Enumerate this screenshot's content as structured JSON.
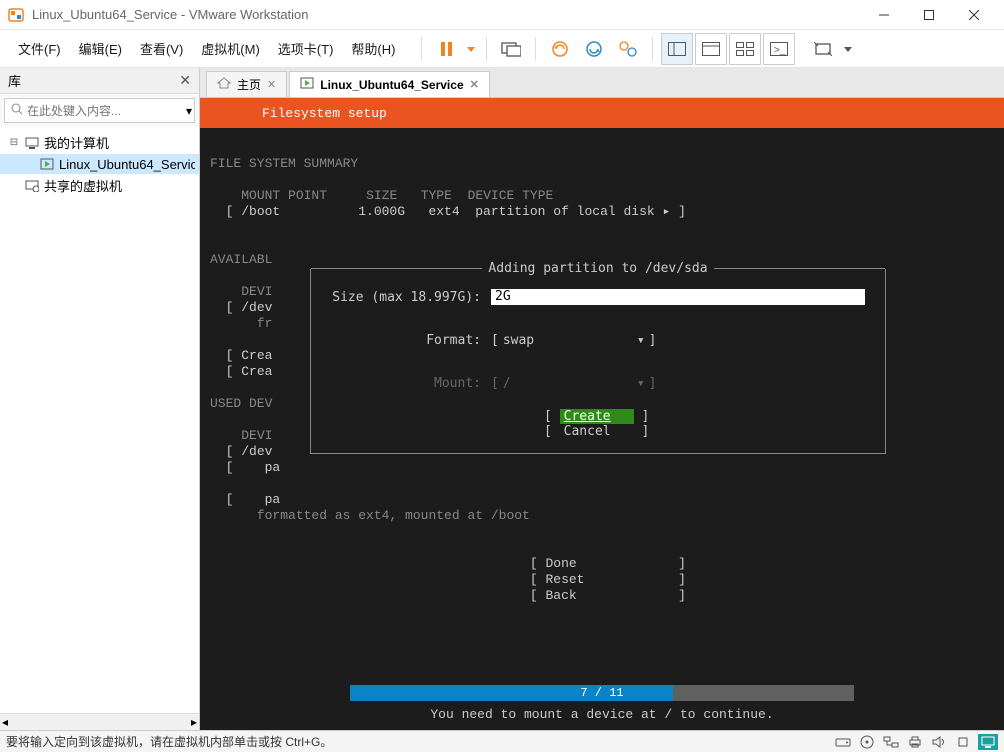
{
  "window": {
    "title": "Linux_Ubuntu64_Service - VMware Workstation"
  },
  "menu": {
    "file": "文件(F)",
    "edit": "编辑(E)",
    "view": "查看(V)",
    "vm": "虚拟机(M)",
    "tabs": "选项卡(T)",
    "help": "帮助(H)"
  },
  "sidebar": {
    "header": "库",
    "search_placeholder": "在此处键入内容...",
    "tree": {
      "root": "我的计算机",
      "vm1": "Linux_Ubuntu64_Service",
      "shared": "共享的虚拟机"
    }
  },
  "tabs": {
    "home": "主页",
    "vm": "Linux_Ubuntu64_Service"
  },
  "console": {
    "header": "Filesystem setup",
    "summary_title": "FILE SYSTEM SUMMARY",
    "col_mount": "MOUNT POINT",
    "col_size": "SIZE",
    "col_type": "TYPE",
    "col_devtype": "DEVICE TYPE",
    "row_boot": "[ /boot          1.000G   ext4  partition of local disk ▸ ]",
    "avail_title": "AVAILABL",
    "avail_devi": "DEVI",
    "avail_dev": "[ /dev",
    "avail_fr": "fr",
    "avail_crea1": "[ Crea",
    "avail_crea2": "[ Crea",
    "used_title": "USED DEV",
    "used_devi": "DEVI",
    "used_dev": "[ /dev",
    "used_pa1": "[    pa",
    "used_pa2": "[    pa",
    "formatted": "formatted as ext4, mounted at /boot",
    "btn_done": "[ Done             ]",
    "btn_reset": "[ Reset            ]",
    "btn_back": "[ Back             ]",
    "progress": "7 / 11",
    "footer_msg": "You need to mount a device at / to continue."
  },
  "dialog": {
    "title": "Adding partition to /dev/sda",
    "size_label": "Size (max 18.997G):",
    "size_value": "2G",
    "format_label": "Format:",
    "format_value": "swap",
    "mount_label": "Mount:",
    "mount_value": "/",
    "create": "Create",
    "cancel": "Cancel"
  },
  "statusbar": {
    "text": "要将输入定向到该虚拟机，请在虚拟机内部单击或按 Ctrl+G。"
  }
}
